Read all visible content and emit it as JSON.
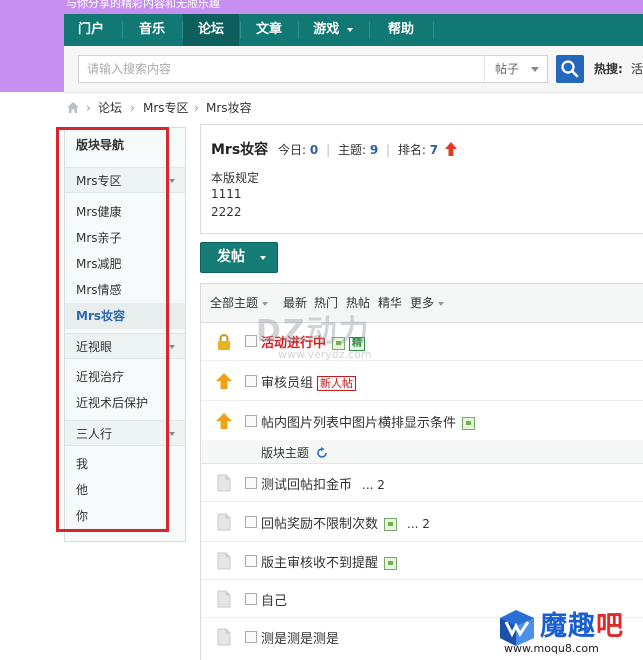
{
  "top_strip": "与你分享的精彩内容和无限乐趣",
  "nav": {
    "items": [
      {
        "label": "门户"
      },
      {
        "label": "音乐"
      },
      {
        "label": "论坛"
      },
      {
        "label": "文章"
      },
      {
        "label": "游戏"
      },
      {
        "label": "帮助"
      }
    ],
    "active": "论坛"
  },
  "search": {
    "placeholder": "请输入搜索内容",
    "type": "帖子",
    "hot_label": "热搜:",
    "hot_value": "活"
  },
  "breadcrumb": [
    "论坛",
    "Mrs专区",
    "Mrs妆容"
  ],
  "sidebar": {
    "title": "版块导航",
    "groups": [
      {
        "name": "Mrs专区",
        "items": [
          "Mrs健康",
          "Mrs亲子",
          "Mrs减肥",
          "Mrs情感",
          "Mrs妆容"
        ]
      },
      {
        "name": "近视眼",
        "items": [
          "近视治疗",
          "近视术后保护"
        ]
      },
      {
        "name": "三人行",
        "items": [
          "我",
          "他",
          "你"
        ]
      }
    ],
    "current": "Mrs妆容"
  },
  "forum": {
    "name": "Mrs妆容",
    "today_label": "今日:",
    "today": "0",
    "topics_label": "主题:",
    "topics": "9",
    "rank_label": "排名:",
    "rank": "7",
    "rules_title": "本版规定",
    "rules": [
      "1111",
      "2222"
    ]
  },
  "post_button": "发帖",
  "filters": {
    "all": "全部主题",
    "latest": "最新",
    "hot": "热门",
    "hot_posts": "热帖",
    "digest": "精华",
    "more": "更多"
  },
  "sticky_threads": [
    {
      "title": "活动进行中",
      "badge": "精",
      "icon": "lock-icon"
    },
    {
      "title": "审核员组",
      "badge": "新人帖",
      "icon": "pin-icon"
    },
    {
      "title": "帖内图片列表中图片横排显示条件",
      "icon": "pin-icon"
    }
  ],
  "section_label": "版块主题",
  "threads": [
    {
      "title": "测试回帖扣金币",
      "pages": "... 2"
    },
    {
      "title": "回帖奖励不限制次数",
      "pages": "... 2"
    },
    {
      "title": "版主审核收不到提醒",
      "pages": ""
    },
    {
      "title": "自己",
      "pages": ""
    },
    {
      "title": "测是测是测是",
      "pages": ""
    }
  ],
  "watermark": {
    "main": "DZ动力",
    "sub": "www.verydz.com"
  },
  "corner_logo": {
    "name_main": "魔趣",
    "name_accent": "吧",
    "url": "www.moqu8.com"
  },
  "colors": {
    "nav": "#127874",
    "accent_blue": "#2468bd",
    "highlight": "#d9262a",
    "band": "#c68ff0"
  }
}
